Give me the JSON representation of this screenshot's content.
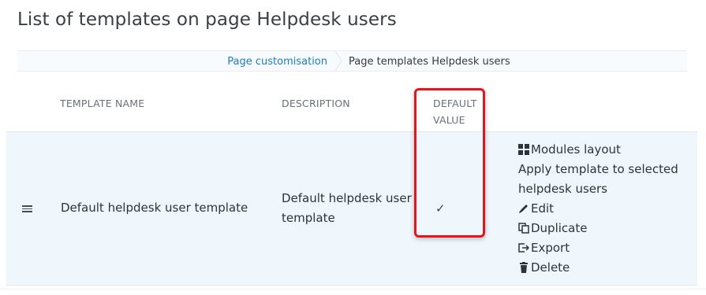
{
  "page": {
    "title": "List of templates on page Helpdesk users"
  },
  "breadcrumb": {
    "parent": "Page customisation",
    "current": "Page templates Helpdesk users"
  },
  "table": {
    "headers": {
      "name": "TEMPLATE NAME",
      "description": "DESCRIPTION",
      "default": "DEFAULT\nVALUE"
    },
    "rows": [
      {
        "name": "Default helpdesk user template",
        "description": "Default helpdesk user template",
        "default_mark": "✓",
        "actions": {
          "modules_layout": "Modules layout",
          "apply": "Apply template to selected helpdesk users",
          "edit": "Edit",
          "duplicate": "Duplicate",
          "export": "Export",
          "delete": "Delete"
        }
      }
    ]
  },
  "colors": {
    "link": "#1e7ac8",
    "row_bg": "#f0f7fc",
    "highlight": "#e8141b"
  },
  "icons": [
    "grid-icon",
    "pencil-icon",
    "duplicate-icon",
    "export-icon",
    "trash-icon",
    "drag-handle-icon",
    "checkmark-icon"
  ]
}
